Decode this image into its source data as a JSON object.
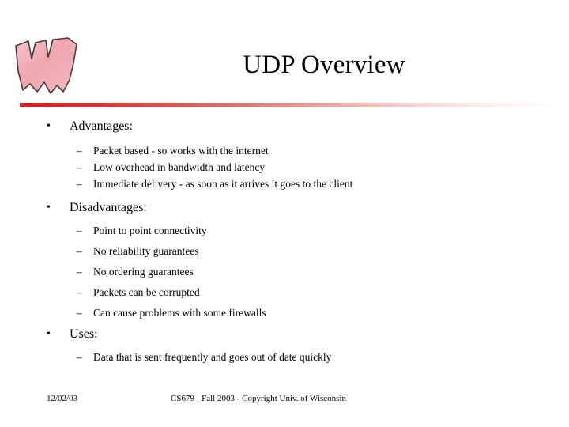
{
  "slide": {
    "title": "UDP Overview",
    "logo_name": "uw-wisconsin-w-logo",
    "accent_color": "#d4201f",
    "sections": [
      {
        "heading": "Advantages:",
        "bullet_glyph": "•",
        "items": [
          "Packet based - so works with the internet",
          "Low overhead in bandwidth and latency",
          "Immediate delivery - as soon as it arrives it goes to the client"
        ]
      },
      {
        "heading": "Disadvantages:",
        "bullet_glyph": "•",
        "items": [
          "Point to point connectivity",
          "No reliability guarantees",
          "No ordering guarantees",
          "Packets can be corrupted",
          "Can cause problems with some firewalls"
        ]
      },
      {
        "heading": "Uses:",
        "bullet_glyph": "•",
        "items": [
          "Data that is sent frequently and goes out of date quickly"
        ]
      }
    ],
    "dash_glyph": "–",
    "footer": {
      "date": "12/02/03",
      "center": "CS679 - Fall 2003 - Copyright Univ. of Wisconsin"
    }
  }
}
